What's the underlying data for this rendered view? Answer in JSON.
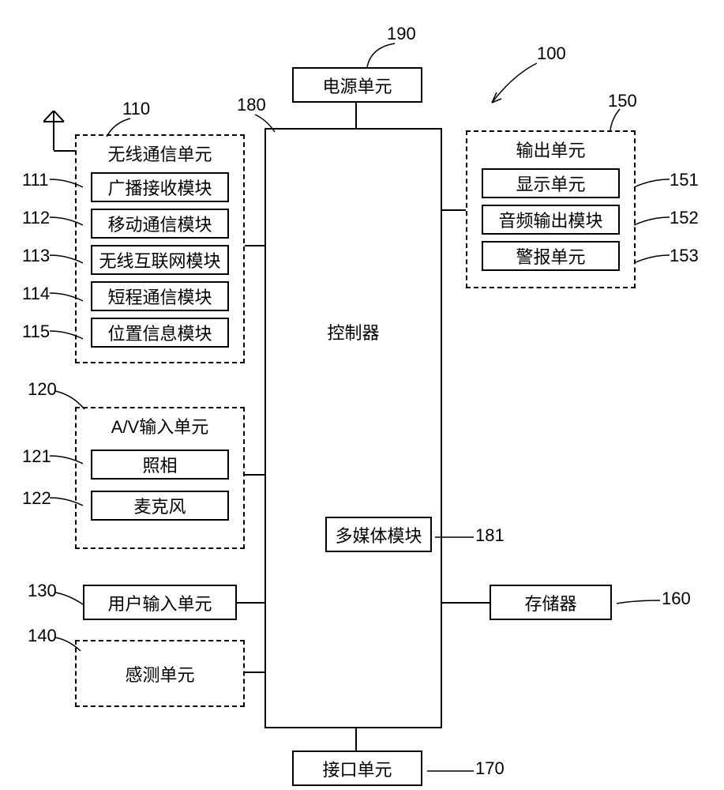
{
  "refs": {
    "r190": "190",
    "r100": "100",
    "r110": "110",
    "r111": "111",
    "r112": "112",
    "r113": "113",
    "r114": "114",
    "r115": "115",
    "r120": "120",
    "r121": "121",
    "r122": "122",
    "r130": "130",
    "r140": "140",
    "r150": "150",
    "r151": "151",
    "r152": "152",
    "r153": "153",
    "r160": "160",
    "r170": "170",
    "r180": "180",
    "r181": "181"
  },
  "blocks": {
    "power": "电源单元",
    "controller": "控制器",
    "multimedia": "多媒体模块",
    "wireless_unit": "无线通信单元",
    "broadcast": "广播接收模块",
    "mobile_comm": "移动通信模块",
    "wireless_net": "无线互联网模块",
    "short_range": "短程通信模块",
    "location": "位置信息模块",
    "av_input": "A/V输入单元",
    "camera": "照相",
    "microphone": "麦克风",
    "user_input": "用户输入单元",
    "sensing": "感测单元",
    "output_unit": "输出单元",
    "display": "显示单元",
    "audio_out": "音频输出模块",
    "alarm": "警报单元",
    "memory": "存储器",
    "interface": "接口单元"
  }
}
